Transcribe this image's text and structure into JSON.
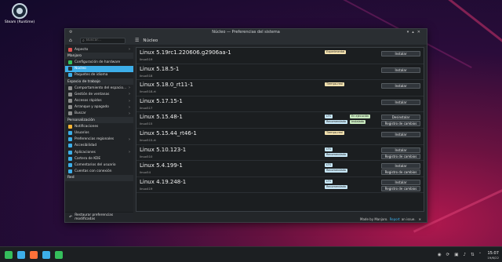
{
  "desktop": {
    "icon_label": "Steam (Runtime)"
  },
  "window": {
    "title": "Núcleo — Preferencias del sistema",
    "search_placeholder": "Buscar...",
    "page_title": "Núcleo",
    "bottom_action": "Restaurar preferencias modificadas"
  },
  "sidebar": [
    {
      "type": "item",
      "label": "Aspecto",
      "icon_color": "#e05252",
      "chevron": true
    },
    {
      "type": "cat",
      "label": "Manjaro"
    },
    {
      "type": "item",
      "label": "Configuración de hardware",
      "icon_color": "#35bf5c",
      "chevron": false
    },
    {
      "type": "item",
      "label": "Núcleo",
      "icon_color": "#2b2b2b",
      "chevron": false,
      "selected": true
    },
    {
      "type": "item",
      "label": "Paquetes de idioma",
      "icon_color": "#3daee9",
      "chevron": false
    },
    {
      "type": "cat",
      "label": "Espacio de trabajo"
    },
    {
      "type": "item",
      "label": "Comportamiento del espacio...",
      "icon_color": "#8e8e8e",
      "chevron": true
    },
    {
      "type": "item",
      "label": "Gestión de ventanas",
      "icon_color": "#8e8e8e",
      "chevron": true
    },
    {
      "type": "item",
      "label": "Accesos rápidos",
      "icon_color": "#8e8e8e",
      "chevron": true
    },
    {
      "type": "item",
      "label": "Arranque y apagado",
      "icon_color": "#8e8e8e",
      "chevron": true
    },
    {
      "type": "item",
      "label": "Buscar",
      "icon_color": "#8e8e8e",
      "chevron": true
    },
    {
      "type": "cat",
      "label": "Personalización"
    },
    {
      "type": "item",
      "label": "Notificaciones",
      "icon_color": "#f5b335",
      "chevron": false
    },
    {
      "type": "item",
      "label": "Usuarios",
      "icon_color": "#3daee9",
      "chevron": false
    },
    {
      "type": "item",
      "label": "Preferencias regionales",
      "icon_color": "#3daee9",
      "chevron": true
    },
    {
      "type": "item",
      "label": "Accesibilidad",
      "icon_color": "#3daee9",
      "chevron": false
    },
    {
      "type": "item",
      "label": "Aplicaciones",
      "icon_color": "#3daee9",
      "chevron": true
    },
    {
      "type": "item",
      "label": "Cartera de KDE",
      "icon_color": "#3daee9",
      "chevron": false
    },
    {
      "type": "item",
      "label": "Comentarios del usuario",
      "icon_color": "#3daee9",
      "chevron": false
    },
    {
      "type": "item",
      "label": "Cuentas con conexión",
      "icon_color": "#3daee9",
      "chevron": false
    },
    {
      "type": "cat",
      "label": "Red"
    }
  ],
  "kernels": [
    {
      "name": "Linux 5.19rc1.220606.g2906aa-1",
      "pkg": "linux519",
      "badges": [
        {
          "text": "Experimental",
          "kind": "exp",
          "col": 0
        }
      ],
      "buttons": [
        "Instalar"
      ]
    },
    {
      "name": "Linux 5.18.5-1",
      "pkg": "linux518",
      "badges": [],
      "buttons": [
        "Instalar"
      ]
    },
    {
      "name": "Linux 5.18.0_rt11-1",
      "pkg": "linux518-rt",
      "badges": [
        {
          "text": "Tiempo-real",
          "kind": "exp",
          "col": 0
        }
      ],
      "buttons": [
        "Instalar"
      ]
    },
    {
      "name": "Linux 5.17.15-1",
      "pkg": "linux517",
      "badges": [],
      "buttons": [
        "Instalar"
      ]
    },
    {
      "name": "Linux 5.15.48-1",
      "pkg": "linux515",
      "badges": [
        {
          "text": "LTS",
          "kind": "lts",
          "col": 0
        },
        {
          "text": "En ejecución",
          "kind": "run",
          "col": 1
        },
        {
          "text": "Recomendado",
          "kind": "lts",
          "col": 0,
          "row2": true
        },
        {
          "text": "Instalado",
          "kind": "run",
          "col": 1,
          "row2": true
        }
      ],
      "buttons": [
        "Desinstalar",
        "Registro de cambios"
      ]
    },
    {
      "name": "Linux 5.15.44_rt46-1",
      "pkg": "linux515-rt",
      "badges": [
        {
          "text": "Tiempo-real",
          "kind": "exp",
          "col": 0
        }
      ],
      "buttons": [
        "Instalar"
      ]
    },
    {
      "name": "Linux 5.10.123-1",
      "pkg": "linux510",
      "badges": [
        {
          "text": "LTS",
          "kind": "lts",
          "col": 0
        },
        {
          "text": "Recomendado",
          "kind": "lts",
          "col": 0,
          "row2": true
        }
      ],
      "buttons": [
        "Instalar",
        "Registro de cambios"
      ]
    },
    {
      "name": "Linux 5.4.199-1",
      "pkg": "linux54",
      "badges": [
        {
          "text": "LTS",
          "kind": "lts",
          "col": 0
        },
        {
          "text": "Recomendado",
          "kind": "lts",
          "col": 0,
          "row2": true
        }
      ],
      "buttons": [
        "Instalar",
        "Registro de cambios"
      ]
    },
    {
      "name": "Linux 4.19.248-1",
      "pkg": "linux419",
      "badges": [
        {
          "text": "LTS",
          "kind": "lts",
          "col": 0
        },
        {
          "text": "Recomendado",
          "kind": "lts",
          "col": 0,
          "row2": true
        }
      ],
      "buttons": [
        "Instalar",
        "Registro de cambios"
      ]
    }
  ],
  "status": {
    "prefix": "Made by Manjaro.",
    "link": "Report",
    "suffix": "an issue."
  },
  "taskbar": {
    "icons": [
      {
        "name": "app-menu-icon",
        "color": "#35bf5c"
      },
      {
        "name": "files-icon",
        "color": "#3daee9"
      },
      {
        "name": "firefox-icon",
        "color": "#ff7139"
      },
      {
        "name": "discover-icon",
        "color": "#3daee9"
      },
      {
        "name": "settings-icon",
        "color": "#35bf5c"
      }
    ],
    "time": "15:07",
    "date": "19/6/22"
  }
}
